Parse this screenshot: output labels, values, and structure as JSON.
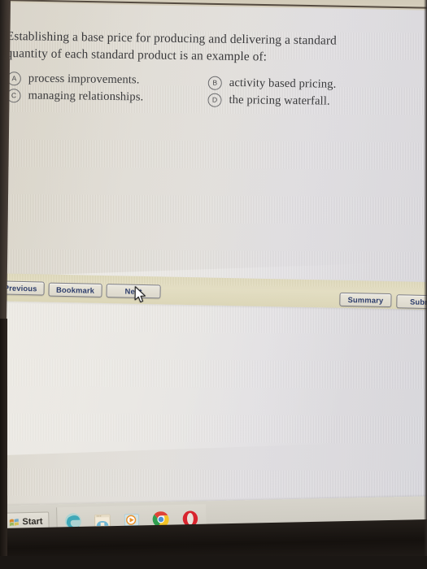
{
  "quiz": {
    "question_line1": "Establishing a base price for producing and delivering a standard",
    "question_line2": "quantity of each standard product is an example of:",
    "options": [
      {
        "letter": "A",
        "text": "process improvements."
      },
      {
        "letter": "B",
        "text": "activity based pricing."
      },
      {
        "letter": "C",
        "text": "managing relationships."
      },
      {
        "letter": "D",
        "text": "the pricing waterfall."
      }
    ]
  },
  "toolbar": {
    "previous_label": "Previous",
    "bookmark_label": "Bookmark",
    "next_label": "Next",
    "summary_label": "Summary",
    "submit_label": "Subm"
  },
  "taskbar": {
    "start_label": "Start",
    "icons": [
      {
        "name": "edge-icon"
      },
      {
        "name": "file-explorer-icon"
      },
      {
        "name": "media-player-icon"
      },
      {
        "name": "chrome-icon"
      },
      {
        "name": "opera-icon"
      }
    ]
  },
  "colors": {
    "button_text": "#2d3d6b",
    "button_bar": "#ded8b9",
    "question_text": "#3a3a3c",
    "screen_warm": "#d8d2c6",
    "screen_cool": "#d4d3d9"
  }
}
